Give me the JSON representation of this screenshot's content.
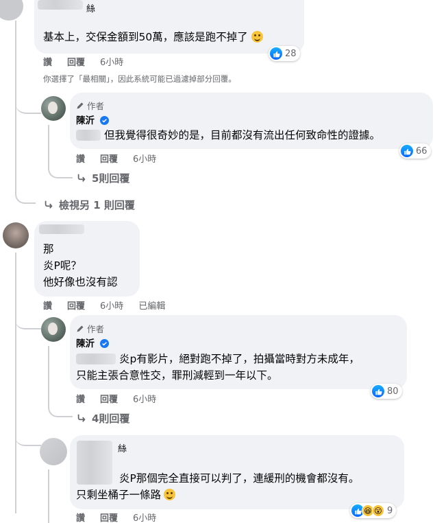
{
  "actions": {
    "like": "讚",
    "reply": "回覆",
    "edited": "已編輯"
  },
  "filter_note": "你選擇了「最相關」，因此系統可能已過濾掉部分回覆。",
  "comments": [
    {
      "name_fragment": "絲",
      "text": "基本上，交保金額到50萬，應該是跑不掉了",
      "time": "6小時",
      "reaction_count": "28"
    },
    {
      "author_label": "作者",
      "name": "陳沂",
      "text": "但我覺得很奇妙的是，目前都沒有流出任何致命性的證據。",
      "time": "6小時",
      "reaction_count": "66",
      "view_replies": "5則回覆"
    },
    {
      "view_more": "檢視另 1 則回覆"
    },
    {
      "lines": [
        "那",
        "炎P呢？",
        "他好像也沒有認"
      ],
      "time": "6小時"
    },
    {
      "author_label": "作者",
      "name": "陳沂",
      "lines": [
        "炎p有影片，絕對跑不掉了，拍攝當時對方未成年，",
        "只能主張合意性交，罪刑減輕到一年以下。"
      ],
      "time": "6小時",
      "reaction_count": "80",
      "view_replies": "4則回覆"
    },
    {
      "name_fragment": "絲",
      "lines": [
        "炎P那個完全直接可以判了，連緩刑的機會都沒有。",
        "只剩坐桶子一條路"
      ],
      "time": "6小時",
      "reaction_count": "9"
    }
  ],
  "colors": {
    "bubble": "#f0f2f5",
    "like_blue": "#1877f2",
    "meta": "#65676b",
    "verified": "#1877f2"
  }
}
